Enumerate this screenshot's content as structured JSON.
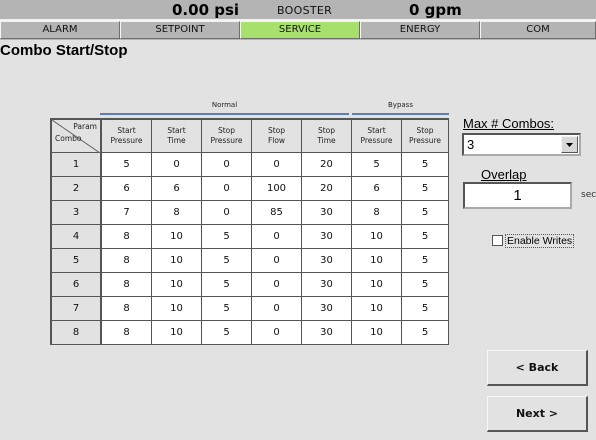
{
  "header": {
    "pressure": "0.00 psi",
    "mode": "BOOSTER",
    "flow": "0 gpm"
  },
  "tabs": [
    {
      "label": "ALARM"
    },
    {
      "label": "SETPOINT"
    },
    {
      "label": "SERVICE",
      "active": true
    },
    {
      "label": "ENERGY"
    },
    {
      "label": "COM"
    }
  ],
  "page_title": "Combo Start/Stop",
  "groups": {
    "normal": "Normal",
    "bypass": "Bypass"
  },
  "table": {
    "corner_param": "Param",
    "corner_combo": "Combo",
    "columns": [
      [
        "Start",
        "Pressure"
      ],
      [
        "Start",
        "Time"
      ],
      [
        "Stop",
        "Pressure"
      ],
      [
        "Stop",
        "Flow"
      ],
      [
        "Stop",
        "Time"
      ],
      [
        "Start",
        "Pressure"
      ],
      [
        "Stop",
        "Pressure"
      ]
    ],
    "rows": [
      {
        "combo": "1",
        "values": [
          "5",
          "0",
          "0",
          "0",
          "20",
          "5",
          "5"
        ]
      },
      {
        "combo": "2",
        "values": [
          "6",
          "6",
          "0",
          "100",
          "20",
          "6",
          "5"
        ]
      },
      {
        "combo": "3",
        "values": [
          "7",
          "8",
          "0",
          "85",
          "30",
          "8",
          "5"
        ]
      },
      {
        "combo": "4",
        "values": [
          "8",
          "10",
          "5",
          "0",
          "30",
          "10",
          "5"
        ]
      },
      {
        "combo": "5",
        "values": [
          "8",
          "10",
          "5",
          "0",
          "30",
          "10",
          "5"
        ]
      },
      {
        "combo": "6",
        "values": [
          "8",
          "10",
          "5",
          "0",
          "30",
          "10",
          "5"
        ]
      },
      {
        "combo": "7",
        "values": [
          "8",
          "10",
          "5",
          "0",
          "30",
          "10",
          "5"
        ]
      },
      {
        "combo": "8",
        "values": [
          "8",
          "10",
          "5",
          "0",
          "30",
          "10",
          "5"
        ]
      }
    ]
  },
  "max_combos": {
    "label": "Max # Combos:",
    "selected": "3"
  },
  "overlap": {
    "label": "Overlap",
    "value": "1",
    "unit": "sec"
  },
  "enable_writes": {
    "label": "Enable Writes",
    "checked": false
  },
  "buttons": {
    "back": "< Back",
    "next": "Next >"
  },
  "colors": {
    "background": "#e2e2e2",
    "header": "#b4b4b4",
    "active_tab": "#a7e06c",
    "group_line": "#5a7fb0"
  },
  "icons": {
    "dropdown": "triangle-down-icon"
  }
}
